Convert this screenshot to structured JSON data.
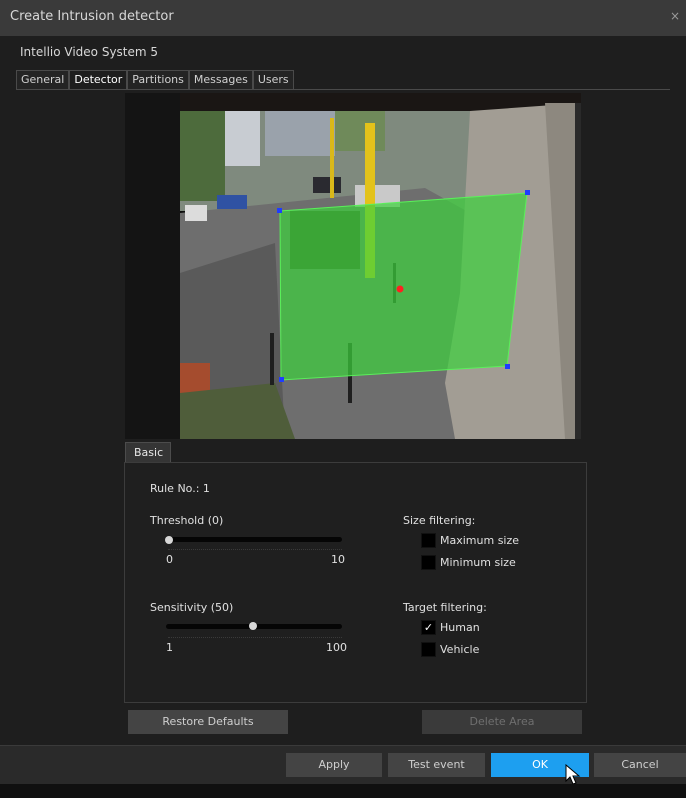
{
  "window": {
    "title": "Create Intrusion detector",
    "close_icon": "×"
  },
  "system_name": "Intellio Video System 5",
  "tabs": [
    {
      "label": "General",
      "active": false
    },
    {
      "label": "Detector",
      "active": true
    },
    {
      "label": "Partitions",
      "active": false
    },
    {
      "label": "Messages",
      "active": false
    },
    {
      "label": "Users",
      "active": false
    }
  ],
  "basic_tab": "Basic",
  "rule": {
    "label": "Rule No.: 1"
  },
  "threshold": {
    "label": "Threshold (0)",
    "min": "0",
    "max": "10",
    "value": 0
  },
  "sensitivity": {
    "label": "Sensitivity (50)",
    "min": "1",
    "max": "100",
    "value": 50
  },
  "size_filtering": {
    "title": "Size filtering:",
    "items": [
      {
        "label": "Maximum size",
        "checked": false
      },
      {
        "label": "Minimum size",
        "checked": false
      }
    ]
  },
  "target_filtering": {
    "title": "Target filtering:",
    "items": [
      {
        "label": "Human",
        "checked": true
      },
      {
        "label": "Vehicle",
        "checked": false
      }
    ]
  },
  "buttons": {
    "restore_defaults": "Restore Defaults",
    "delete_area": "Delete Area",
    "apply": "Apply",
    "test_event": "Test event",
    "ok": "OK",
    "cancel": "Cancel"
  },
  "colors": {
    "primary": "#1d9ff0",
    "detection_zone": "#3cd23c",
    "zone_handle": "#1f3cff",
    "zone_center": "#ff2020"
  }
}
